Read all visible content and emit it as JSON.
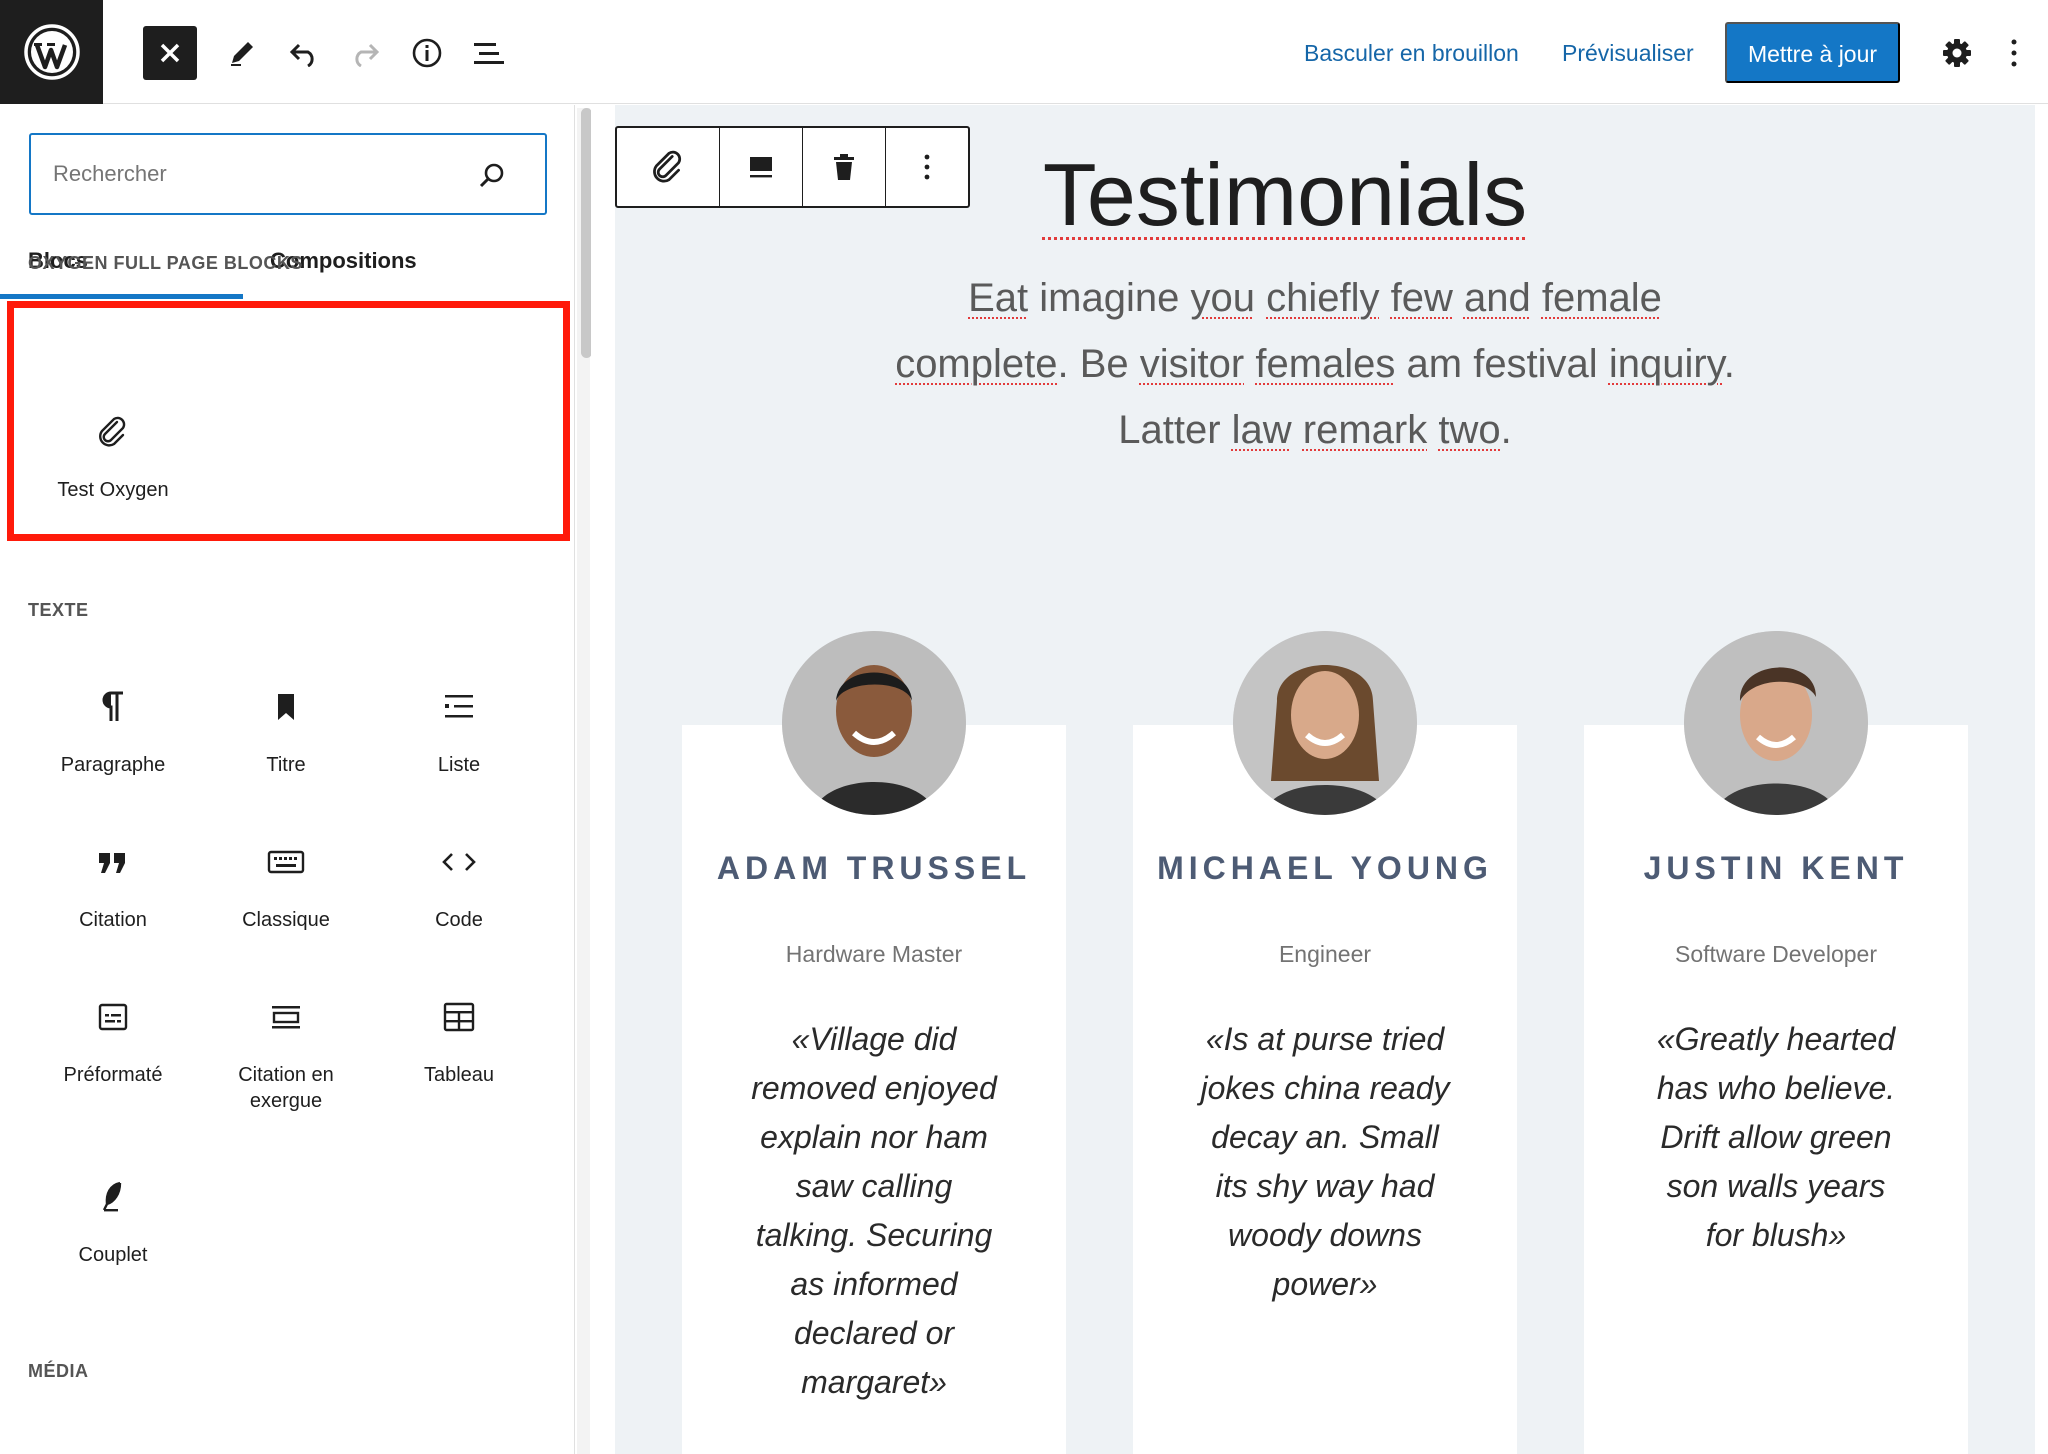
{
  "topbar": {
    "close_icon": "close-icon",
    "draft_label": "Basculer en brouillon",
    "preview_label": "Prévisualiser",
    "update_label": "Mettre à jour"
  },
  "sidebar": {
    "search_placeholder": "Rechercher",
    "tabs": [
      "Blocs",
      "Compositions"
    ],
    "oxygen_category": "OXYGEN FULL PAGE BLOCKS",
    "oxygen_block": "Test Oxygen",
    "text_category": "TEXTE",
    "text_blocks": [
      "Paragraphe",
      "Titre",
      "Liste",
      "Citation",
      "Classique",
      "Code",
      "Préformaté",
      "Citation en exergue",
      "Tableau",
      "Couplet"
    ],
    "media_category": "MÉDIA"
  },
  "canvas": {
    "title": "Testimonials",
    "intro_parts": [
      "Eat",
      " imagine ",
      "you",
      " ",
      "chiefly",
      " ",
      "few",
      " ",
      "and",
      " ",
      "female",
      " ",
      "complete",
      ". Be ",
      "visitor",
      " ",
      "females",
      " am festival ",
      "inquiry",
      ". Latter ",
      "law",
      " ",
      "remark",
      " ",
      "two",
      "."
    ],
    "testimonials": [
      {
        "name": "ADAM TRUSSEL",
        "role": "Hardware Master",
        "quote": "«Village did removed enjoyed explain nor ham saw calling talking. Securing as informed declared or margaret»"
      },
      {
        "name": "MICHAEL YOUNG",
        "role": "Engineer",
        "quote": "«Is at purse tried jokes china ready decay an. Small its shy way had woody downs power»"
      },
      {
        "name": "JUSTIN KENT",
        "role": "Software Developer",
        "quote": "«Greatly hearted has who believe. Drift allow green son walls years for blush»"
      }
    ]
  },
  "colors": {
    "accent": "#1477c6",
    "highlight_border": "#ff1a0a",
    "card_name": "#4d5b74",
    "canvas_bg": "#eef2f5"
  }
}
